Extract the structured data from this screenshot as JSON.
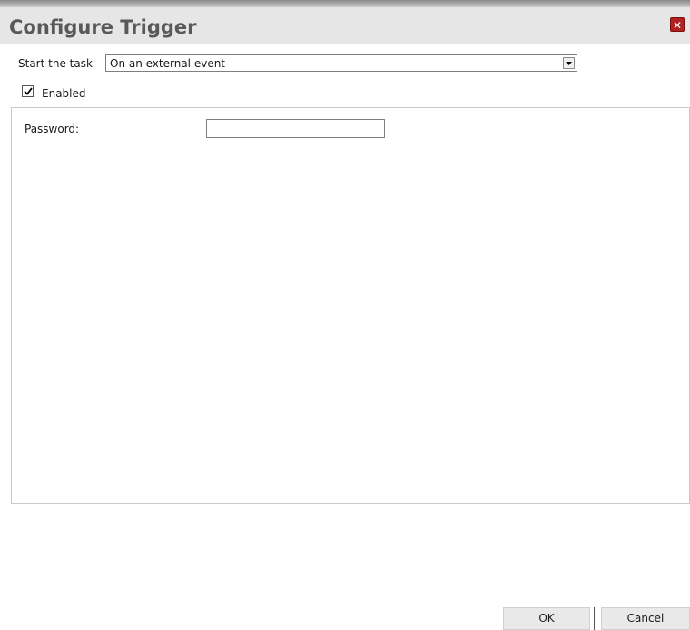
{
  "dialog": {
    "title": "Configure Trigger",
    "close_icon": "close-icon",
    "accent_close_color": "#b22222"
  },
  "start_task": {
    "label": "Start the task",
    "selected": "On an external event"
  },
  "enabled": {
    "label": "Enabled",
    "checked": true
  },
  "password": {
    "label": "Password:",
    "value": ""
  },
  "buttons": {
    "ok": "OK",
    "cancel": "Cancel"
  }
}
